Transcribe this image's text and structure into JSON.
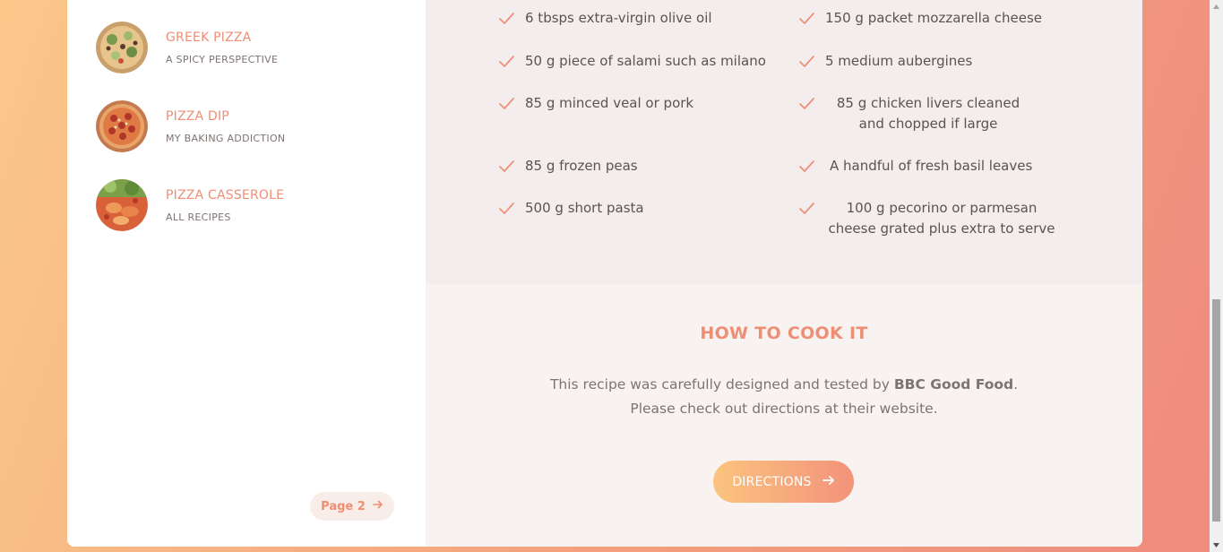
{
  "sidebar": {
    "recipes": [
      {
        "title": "GREEK PIZZA",
        "source": "A SPICY PERSPECTIVE"
      },
      {
        "title": "PIZZA DIP",
        "source": "MY BAKING ADDICTION"
      },
      {
        "title": "PIZZA CASSEROLE",
        "source": "ALL RECIPES"
      }
    ],
    "page_button": "Page 2"
  },
  "ingredients": {
    "left": [
      "6 tbsps extra-virgin olive oil",
      "50 g piece of salami such as milano",
      "85 g minced veal or pork",
      "85 g frozen peas",
      "500 g short pasta"
    ],
    "right": [
      "150 g packet mozzarella cheese",
      "5 medium aubergines",
      "85 g chicken livers cleaned and chopped if large",
      "A handful of fresh basil leaves",
      "100 g pecorino or parmesan cheese grated plus extra to serve"
    ]
  },
  "cook": {
    "title": "HOW TO COOK IT",
    "desc_before": "This recipe was carefully designed and tested by ",
    "desc_publisher": "BBC Good Food",
    "desc_after": ". Please check out directions at their website.",
    "button": "DIRECTIONS"
  },
  "colors": {
    "accent": "#ee8e74",
    "ingredients_bg": "#f3eded",
    "cook_bg": "#f8f3f1"
  },
  "icons": [
    "check-icon",
    "arrow-right-icon"
  ]
}
